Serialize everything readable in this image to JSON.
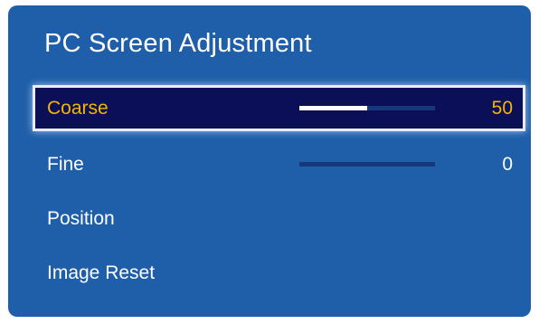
{
  "menu": {
    "title": "PC Screen Adjustment",
    "items": [
      {
        "label": "Coarse",
        "value": "50",
        "level": 0.5
      },
      {
        "label": "Fine",
        "value": "0",
        "level": 0.0
      },
      {
        "label": "Position"
      },
      {
        "label": "Image Reset"
      }
    ]
  },
  "colors": {
    "panel": "#1f5ea8",
    "selected_background": "#0a0f57",
    "selected_text": "#f7b500",
    "slider_track": "#16387a",
    "slider_fill": "#ffffff"
  }
}
